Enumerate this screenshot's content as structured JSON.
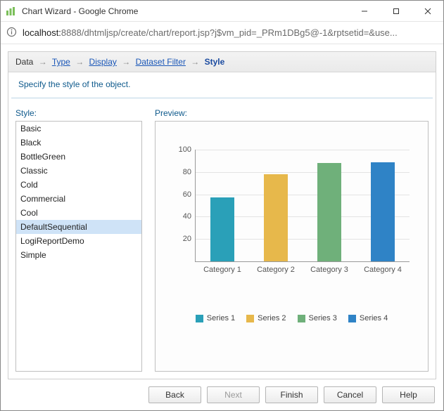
{
  "window": {
    "title": "Chart Wizard - Google Chrome",
    "url_prefix": "localhost:",
    "url_rest": "8888/dhtmljsp/create/chart/report.jsp?j$vm_pid=_PRm1DBg5@-1&rptsetid=&use..."
  },
  "breadcrumb": {
    "data": "Data",
    "type": "Type",
    "display": "Display",
    "dataset_filter": "Dataset Filter",
    "style": "Style"
  },
  "instruction": "Specify the style of the object.",
  "labels": {
    "style": "Style:",
    "preview": "Preview:"
  },
  "styles": {
    "items": [
      "Basic",
      "Black",
      "BottleGreen",
      "Classic",
      "Cold",
      "Commercial",
      "Cool",
      "DefaultSequential",
      "LogiReportDemo",
      "Simple"
    ],
    "selected": "DefaultSequential"
  },
  "chart_data": {
    "type": "bar",
    "categories": [
      "Category 1",
      "Category 2",
      "Category 3",
      "Category 4"
    ],
    "series": [
      {
        "name": "Series 1",
        "color": "#2aa0b8",
        "values": [
          57,
          null,
          null,
          null
        ]
      },
      {
        "name": "Series 2",
        "color": "#e7b84b",
        "values": [
          null,
          78,
          null,
          null
        ]
      },
      {
        "name": "Series 3",
        "color": "#6fb07a",
        "values": [
          null,
          null,
          88,
          null
        ]
      },
      {
        "name": "Series 4",
        "color": "#2f83c6",
        "values": [
          null,
          null,
          null,
          89
        ]
      }
    ],
    "ylim": [
      0,
      100
    ],
    "yticks": [
      20,
      40,
      60,
      80,
      100
    ]
  },
  "buttons": {
    "back": "Back",
    "next": "Next",
    "finish": "Finish",
    "cancel": "Cancel",
    "help": "Help"
  }
}
